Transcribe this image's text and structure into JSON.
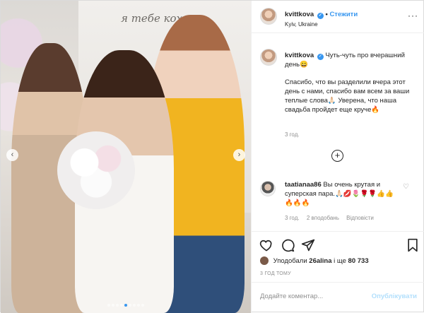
{
  "photo": {
    "wall_text": "я тебе кохаю",
    "carousel_dots": 9,
    "active_dot": 5,
    "arrow_left": "‹",
    "arrow_right": "›"
  },
  "header": {
    "username": "kvittkova",
    "verified_mark": "✓",
    "separator": "•",
    "follow_label": "Стежити",
    "location": "Kyiv, Ukraine",
    "more_label": "···"
  },
  "caption": {
    "username": "kvittkova",
    "verified_mark": "✓",
    "lead": "Чуть-чуть про вчерашний день😄",
    "body": "Спасибо, что вы разделили вчера этот день с нами, спасибо вам всем за ваши теплые слова🙏🏻 Уверена, что наша свадьба пройдет еще круче🔥",
    "time": "3 год."
  },
  "load_more": "+",
  "comment": {
    "username": "taatianaa86",
    "text": "Вы очень крутая и суперская пара.🙏🏻💋🌷🌹🌹👍👍🔥🔥🔥",
    "time": "3 год.",
    "likes": "2 вподобань",
    "reply": "Відповісти",
    "heart": "♡"
  },
  "likes": {
    "label_prefix": "Уподобали",
    "liker": "26alina",
    "label_suffix": "і ще",
    "count": "80 733"
  },
  "ago": "3 ГОД ТОМУ",
  "add_comment": {
    "placeholder": "Додайте коментар...",
    "post_label": "Опублікувати"
  },
  "colors": {
    "accent": "#3897f0",
    "muted": "#8e8e8e",
    "post_disabled": "#b2dffc"
  }
}
